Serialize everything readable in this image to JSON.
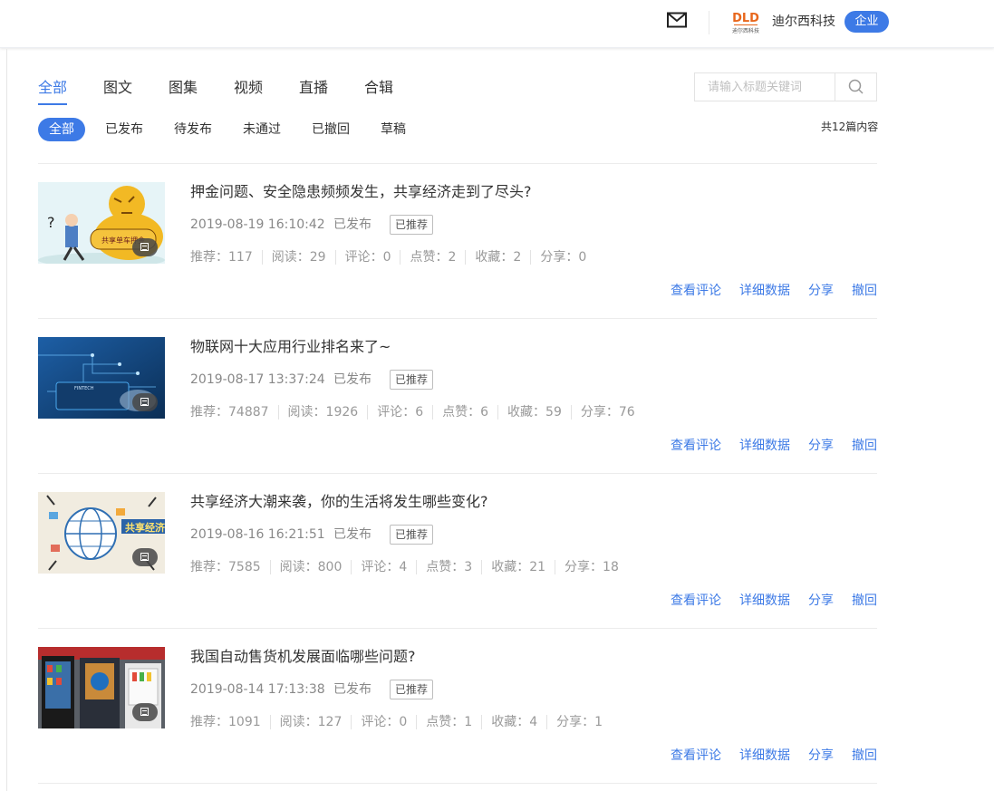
{
  "header": {
    "company_name": "迪尔西科技",
    "badge": "企业",
    "logo_text": "DLD",
    "logo_subtext": "迪尔西科技"
  },
  "tabs": [
    "全部",
    "图文",
    "图集",
    "视频",
    "直播",
    "合辑"
  ],
  "active_tab": "全部",
  "search": {
    "placeholder": "请输入标题关键词",
    "value": ""
  },
  "filters": [
    "全部",
    "已发布",
    "待发布",
    "未通过",
    "已撤回",
    "草稿"
  ],
  "active_filter": "全部",
  "total_count": "共12篇内容",
  "labels": {
    "recommend": "推荐",
    "read": "阅读",
    "comment": "评论",
    "like": "点赞",
    "collect": "收藏",
    "share": "分享",
    "colon": "："
  },
  "actions": [
    "查看评论",
    "详细数据",
    "分享",
    "撤回"
  ],
  "articles": [
    {
      "title": "押金问题、安全隐患频频发生，共享经济走到了尽头?",
      "date": "2019-08-19 16:10:42",
      "status": "已发布",
      "tag": "已推荐",
      "recommend": "117",
      "read": "29",
      "comment": "0",
      "like": "2",
      "collect": "2",
      "share": "0",
      "thumb_text": "共享单车押金"
    },
    {
      "title": "物联网十大应用行业排名来了~",
      "date": "2019-08-17 13:37:24",
      "status": "已发布",
      "tag": "已推荐",
      "recommend": "74887",
      "read": "1926",
      "comment": "6",
      "like": "6",
      "collect": "59",
      "share": "76",
      "thumb_text": "FINTECH"
    },
    {
      "title": "共享经济大潮来袭，你的生活将发生哪些变化?",
      "date": "2019-08-16 16:21:51",
      "status": "已发布",
      "tag": "已推荐",
      "recommend": "7585",
      "read": "800",
      "comment": "4",
      "like": "3",
      "collect": "21",
      "share": "18",
      "thumb_text": "共享经济"
    },
    {
      "title": "我国自动售货机发展面临哪些问题?",
      "date": "2019-08-14 17:13:38",
      "status": "已发布",
      "tag": "已推荐",
      "recommend": "1091",
      "read": "127",
      "comment": "0",
      "like": "1",
      "collect": "4",
      "share": "1",
      "thumb_text": ""
    }
  ],
  "colors": {
    "accent": "#3d7ae6",
    "text": "#333333",
    "muted": "#888888"
  }
}
